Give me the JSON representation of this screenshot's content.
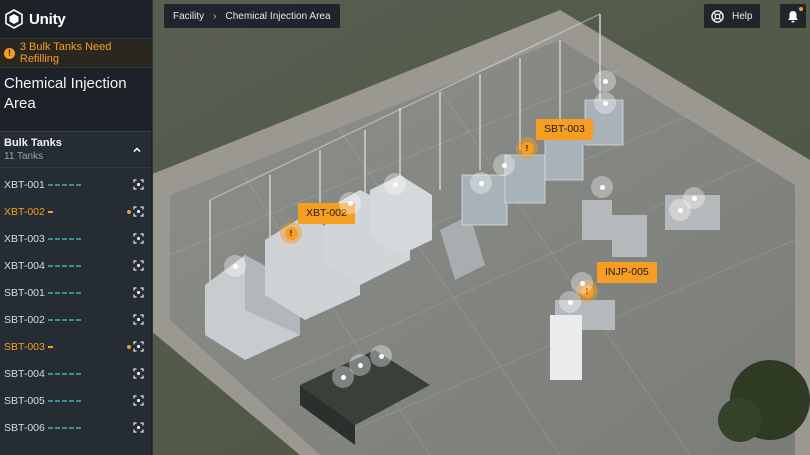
{
  "app": {
    "name": "Unity"
  },
  "alert": {
    "icon": "warning-icon",
    "text": "3 Bulk Tanks Need Refilling"
  },
  "area": {
    "title": "Chemical Injection Area"
  },
  "panel": {
    "title": "Bulk Tanks",
    "subtitle": "11 Tanks",
    "rows": [
      {
        "label": "XBT-001",
        "warn": false
      },
      {
        "label": "XBT-002",
        "warn": true
      },
      {
        "label": "XBT-003",
        "warn": false
      },
      {
        "label": "XBT-004",
        "warn": false
      },
      {
        "label": "SBT-001",
        "warn": false
      },
      {
        "label": "SBT-002",
        "warn": false
      },
      {
        "label": "SBT-003",
        "warn": true
      },
      {
        "label": "SBT-004",
        "warn": false
      },
      {
        "label": "SBT-005",
        "warn": false
      },
      {
        "label": "SBT-006",
        "warn": false
      }
    ]
  },
  "breadcrumb": {
    "root": "Facility",
    "current": "Chemical Injection Area"
  },
  "toolbar": {
    "help_label": "Help",
    "help_icon": "lifebuoy-icon",
    "bell_icon": "bell-icon"
  },
  "scene_tags": {
    "xbt_002": "XBT-002",
    "sbt_003": "SBT-003",
    "injp_005": "INJP-005"
  },
  "colors": {
    "accent": "#f59e21",
    "sidebar": "#1d2228",
    "teal": "#3d8f95"
  }
}
